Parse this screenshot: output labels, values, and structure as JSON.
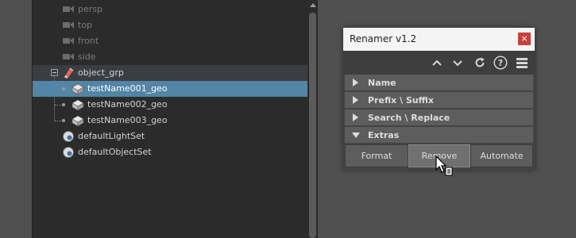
{
  "outliner": {
    "cameras": [
      {
        "label": "persp"
      },
      {
        "label": "top"
      },
      {
        "label": "front"
      },
      {
        "label": "side"
      }
    ],
    "group": {
      "label": "object_grp"
    },
    "children": [
      {
        "label": "testName001_geo"
      },
      {
        "label": "testName002_geo"
      },
      {
        "label": "testName003_geo"
      }
    ],
    "sets": [
      {
        "label": "defaultLightSet"
      },
      {
        "label": "defaultObjectSet"
      }
    ]
  },
  "renamer": {
    "title": "Renamer v1.2",
    "close": "×",
    "toolbar_icons": [
      "chevron-up-icon",
      "chevron-down-icon",
      "refresh-icon",
      "help-icon",
      "menu-icon"
    ],
    "toolbar_help": "?",
    "sections": [
      {
        "label": "Name",
        "expanded": false
      },
      {
        "label": "Prefix \\ Suffix",
        "expanded": false
      },
      {
        "label": "Search \\ Replace",
        "expanded": false
      },
      {
        "label": "Extras",
        "expanded": true
      }
    ],
    "buttons": [
      {
        "label": "Format"
      },
      {
        "label": "Remove"
      },
      {
        "label": "Automate"
      }
    ]
  },
  "colors": {
    "selection": "#5285a6",
    "close_button": "#c5413b"
  }
}
